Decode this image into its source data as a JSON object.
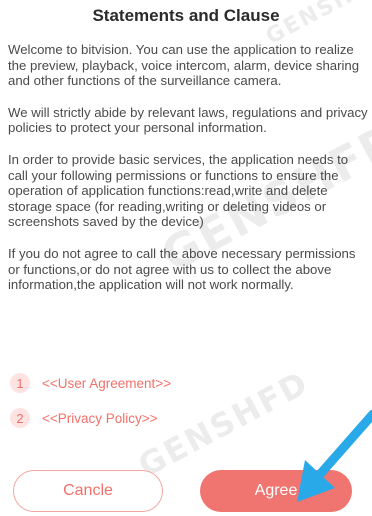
{
  "dialog": {
    "title": "Statements and Clause",
    "paragraphs": [
      "Welcome to bitvision. You can use the application to realize the preview, playback, voice intercom, alarm, device sharing and other functions of the surveillance camera.",
      "We will strictly abide by relevant laws, regulations and privacy policies to protect your personal information.",
      "In order to provide basic services, the application needs to call your following permissions or functions to ensure the operation of application functions:read,write and delete storage space (for reading,writing or deleting videos or screenshots saved by the device)",
      "If you do not agree to call the above necessary permissions or functions,or do not agree with us to collect the above information,the application will not work normally."
    ],
    "links": [
      {
        "number": "1",
        "label": "<<User Agreement>>"
      },
      {
        "number": "2",
        "label": "<<Privacy Policy>>"
      }
    ],
    "buttons": {
      "cancel": "Cancle",
      "agree": "Agree"
    }
  },
  "colors": {
    "accent": "#f07571",
    "link": "#f1706a",
    "arrow": "#2aa9e8"
  }
}
